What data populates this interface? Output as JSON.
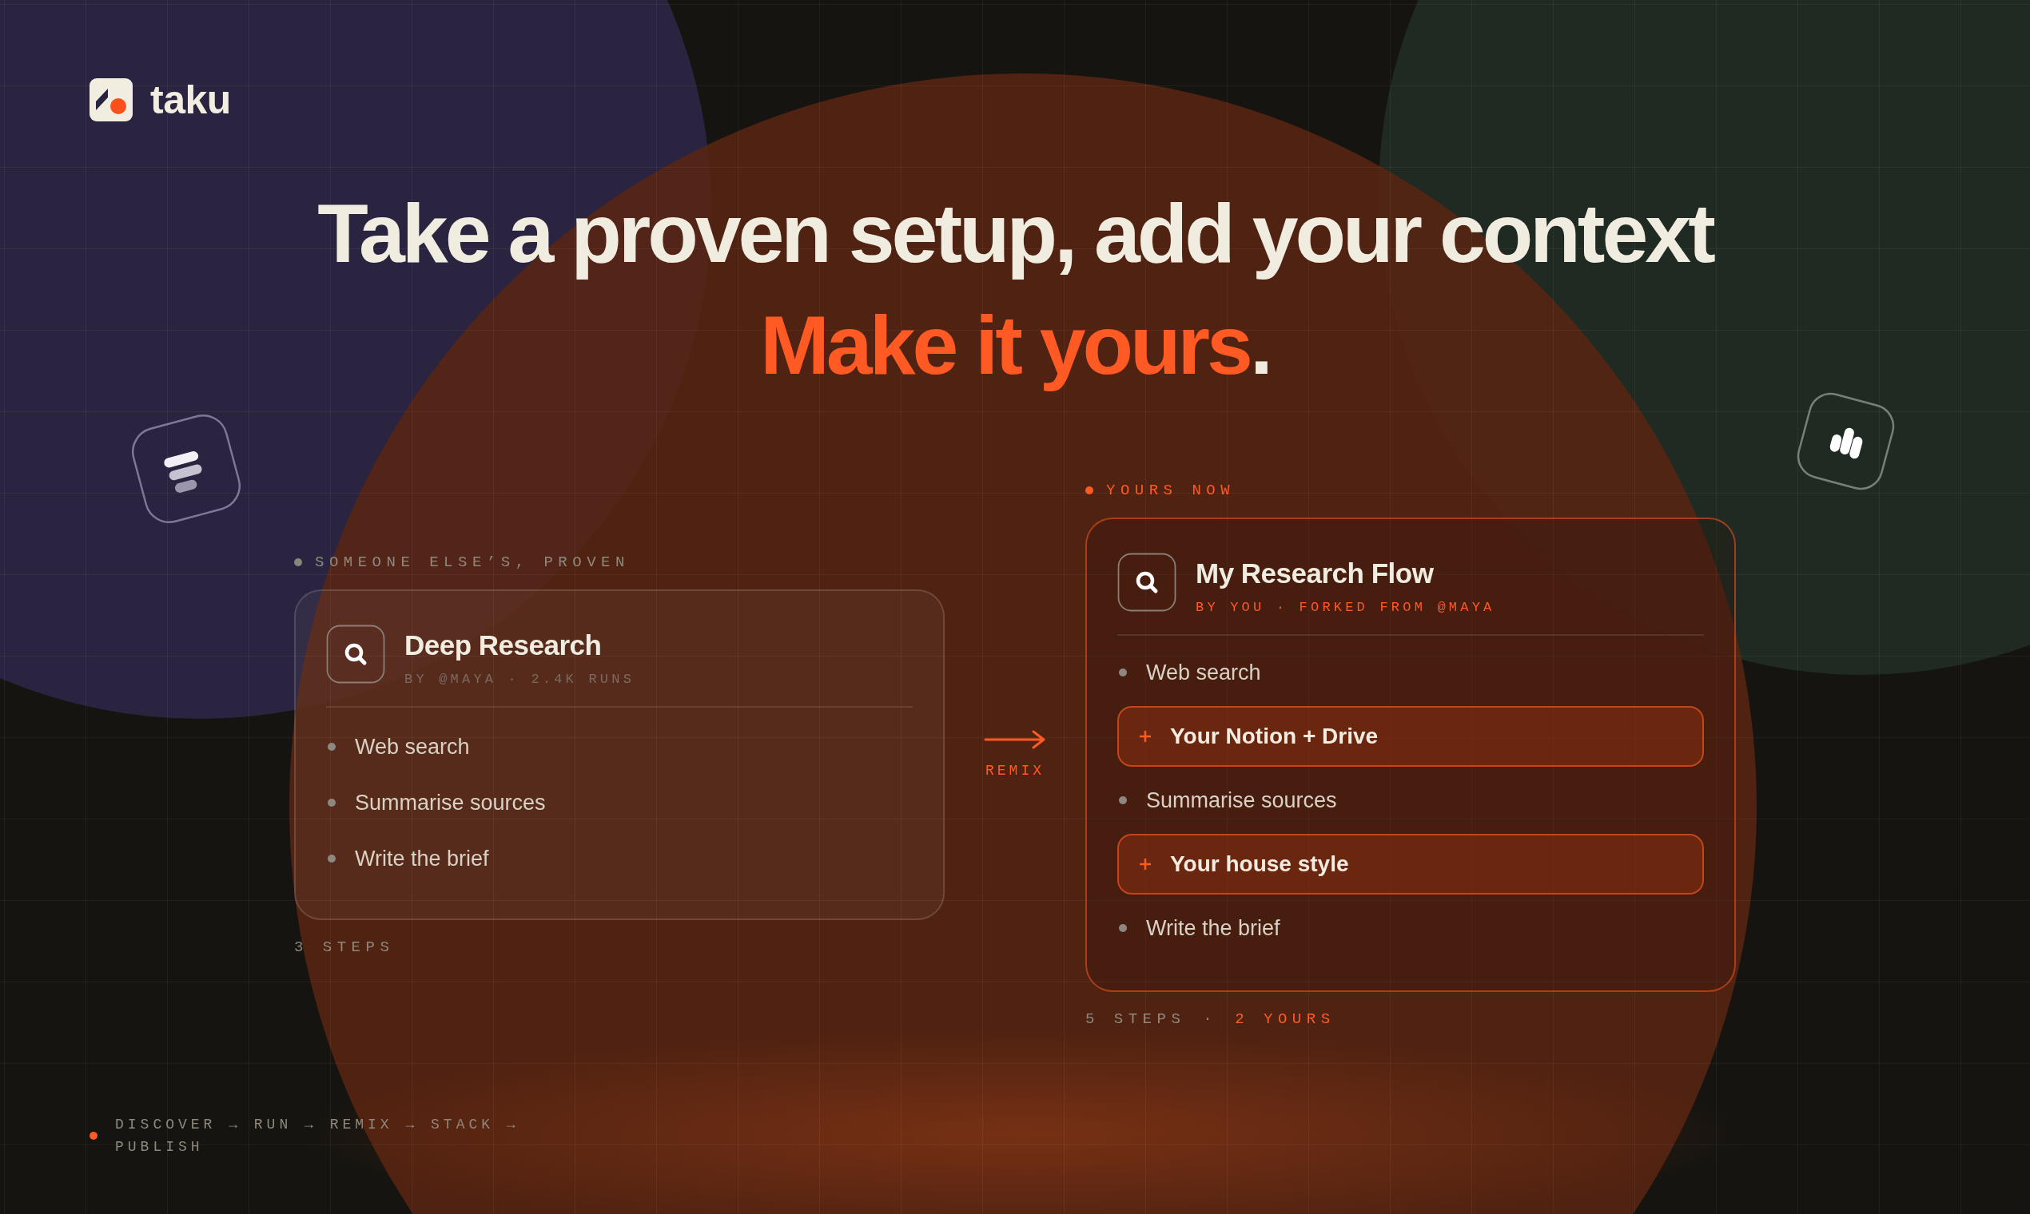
{
  "brand": {
    "name": "taku"
  },
  "headline": {
    "line_1": "Take a proven setup, add your context",
    "line_2": "Make it yours",
    "line_2_end": "."
  },
  "source": {
    "label": "SOMEONE ELSE’S, PROVEN",
    "title": "Deep Research",
    "meta": "BY @MAYA · 2.4K RUNS",
    "steps": [
      {
        "kind": "step",
        "text": "Web search"
      },
      {
        "kind": "step",
        "text": "Summarise sources"
      },
      {
        "kind": "step",
        "text": "Write the brief"
      }
    ],
    "footer": "3 STEPS"
  },
  "remix": {
    "label": "REMIX"
  },
  "fork": {
    "label": "YOURS NOW",
    "title": "My Research Flow",
    "meta": "BY YOU · FORKED FROM @MAYA",
    "steps": [
      {
        "kind": "step",
        "text": "Web search"
      },
      {
        "kind": "added",
        "text": "Your Notion + Drive"
      },
      {
        "kind": "step",
        "text": "Summarise sources"
      },
      {
        "kind": "added",
        "text": "Your house style"
      },
      {
        "kind": "step",
        "text": "Write the brief"
      }
    ],
    "footer_steps": "5 STEPS",
    "footer_separator": "·",
    "footer_yours": "2 YOURS"
  },
  "nav": {
    "text": "DISCOVER → RUN → REMIX → STACK → PUBLISH"
  }
}
